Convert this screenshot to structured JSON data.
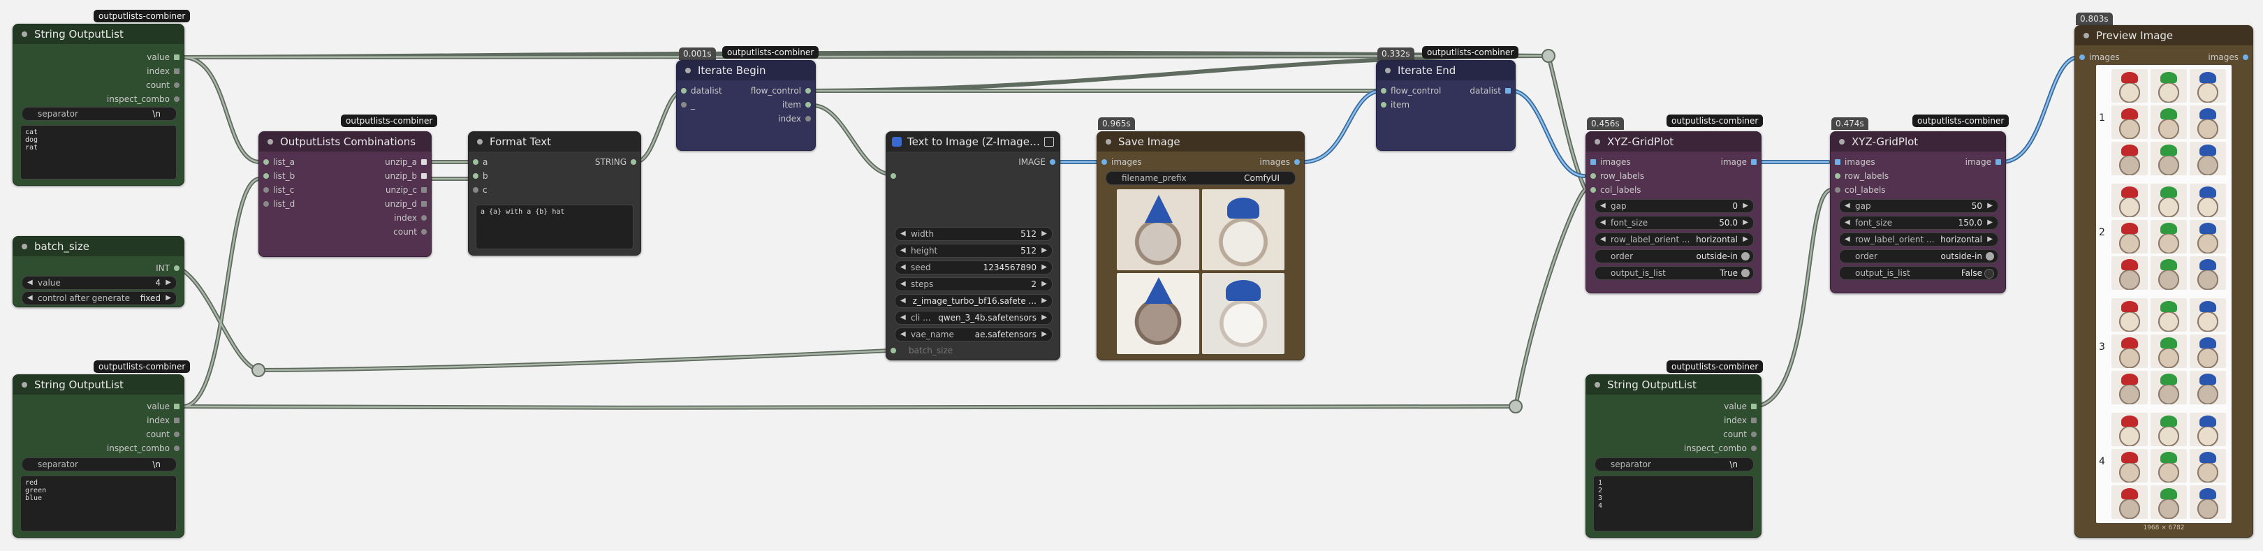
{
  "nodes": {
    "str1": {
      "tag": "outputlists-combiner",
      "title": "String OutputList",
      "outputs": [
        "value",
        "index",
        "count",
        "inspect_combo"
      ],
      "separator_label": "separator",
      "separator_value": "\\n",
      "text": "cat\ndog\nrat"
    },
    "batch": {
      "title": "batch_size",
      "output": "INT",
      "value_label": "value",
      "value": "4",
      "control_label": "control after generate",
      "control_value": "fixed"
    },
    "str2": {
      "tag": "outputlists-combiner",
      "title": "String OutputList",
      "outputs": [
        "value",
        "index",
        "count",
        "inspect_combo"
      ],
      "separator_label": "separator",
      "separator_value": "\\n",
      "text": "red\ngreen\nblue"
    },
    "combo": {
      "tag": "outputlists-combiner",
      "title": "OutputLists Combinations",
      "inputs": [
        "list_a",
        "list_b",
        "list_c",
        "list_d"
      ],
      "outputs": [
        "unzip_a",
        "unzip_b",
        "unzip_c",
        "unzip_d",
        "index",
        "count"
      ]
    },
    "format": {
      "title": "Format Text",
      "inputs": [
        "a",
        "b",
        "c"
      ],
      "output": "STRING",
      "text": "a {a} with a {b} hat"
    },
    "iterbegin": {
      "timing": "0.001s",
      "tag": "outputlists-combiner",
      "title": "Iterate Begin",
      "inputs": [
        "datalist",
        "_"
      ],
      "outputs": [
        "flow_control",
        "item",
        "index"
      ]
    },
    "t2i": {
      "title": "Text to Image (Z-Image-Tu...",
      "output": "IMAGE",
      "widgets": [
        {
          "l": "width",
          "v": "512"
        },
        {
          "l": "height",
          "v": "512"
        },
        {
          "l": "seed",
          "v": "1234567890"
        },
        {
          "l": "steps",
          "v": "2"
        },
        {
          "l": "",
          "v": "z_image_turbo_bf16.safete ..."
        },
        {
          "l": "cli ...",
          "v": "qwen_3_4b.safetensors"
        },
        {
          "l": "vae_name",
          "v": "ae.safetensors"
        }
      ],
      "batch_label": "batch_size"
    },
    "save": {
      "timing": "0.965s",
      "title": "Save Image",
      "input": "images",
      "output": "images",
      "prefix_label": "filename_prefix",
      "prefix_value": "ComfyUI"
    },
    "iterend": {
      "timing": "0.332s",
      "tag": "outputlists-combiner",
      "title": "Iterate End",
      "inputs": [
        "flow_control",
        "item"
      ],
      "output": "datalist"
    },
    "xyz1": {
      "timing": "0.456s",
      "tag": "outputlists-combiner",
      "title": "XYZ-GridPlot",
      "inputs": [
        "images",
        "row_labels",
        "col_labels"
      ],
      "output": "image",
      "widgets": [
        {
          "l": "gap",
          "v": "0"
        },
        {
          "l": "font_size",
          "v": "50.0"
        },
        {
          "l": "row_label_orient ...",
          "v": "horizontal"
        },
        {
          "l": "order",
          "v": "outside-in"
        },
        {
          "l": "output_is_list",
          "v": "True"
        }
      ]
    },
    "xyz2": {
      "timing": "0.474s",
      "tag": "outputlists-combiner",
      "title": "XYZ-GridPlot",
      "inputs": [
        "images",
        "row_labels",
        "col_labels"
      ],
      "output": "image",
      "widgets": [
        {
          "l": "gap",
          "v": "50"
        },
        {
          "l": "font_size",
          "v": "150.0"
        },
        {
          "l": "row_label_orient ...",
          "v": "horizontal"
        },
        {
          "l": "order",
          "v": "outside-in"
        },
        {
          "l": "output_is_list",
          "v": "False"
        }
      ]
    },
    "str3": {
      "tag": "outputlists-combiner",
      "title": "String OutputList",
      "outputs": [
        "value",
        "index",
        "count",
        "inspect_combo"
      ],
      "separator_label": "separator",
      "separator_value": "\\n",
      "text": "1\n2\n3\n4"
    },
    "preview": {
      "timing": "0.803s",
      "title": "Preview Image",
      "input": "images",
      "output": "images",
      "row_labels": [
        "1",
        "2",
        "3",
        "4"
      ],
      "footer": "1968 × 6782"
    }
  },
  "colors": {
    "canvas": "#f2f2f2",
    "wire": "#7f8c7d",
    "image_wire": "#6fa6dc",
    "accent": "#9ec29e"
  }
}
